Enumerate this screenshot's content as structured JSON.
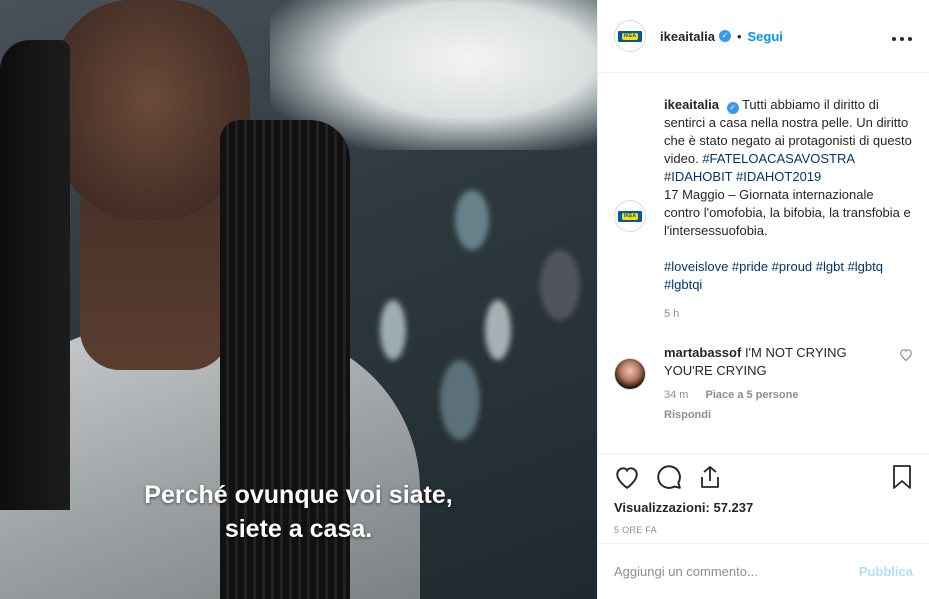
{
  "media": {
    "subtitle_line1": "Perché ovunque voi siate,",
    "subtitle_line2": "siete a casa."
  },
  "header": {
    "username": "ikeaitalia",
    "separator": "•",
    "follow_label": "Segui",
    "more_label": "•••",
    "logo_text": "IKEA"
  },
  "caption": {
    "username": "ikeaitalia",
    "text1": "Tutti abbiamo il diritto di sentirci a casa nella nostra pelle. Un diritto che è stato negato ai protagonisti di questo video.",
    "hashtags1": "#FATELOACASAVOSTRA #IDAHOBIT #IDAHOT2019",
    "text2": "17 Maggio – Giornata internazionale contro l'omofobia, la bifobia, la transfobia e l'intersessuofobia.",
    "hashtags2": "#loveislove #pride #proud #lgbt #lgbtq #lgbtqi",
    "time": "5 h"
  },
  "reply": {
    "username": "martabassof",
    "text": "I'M NOT CRYING YOU'RE CRYING",
    "time": "34 m",
    "likes": "Piace a 5 persone",
    "answer_label": "Rispondi"
  },
  "actions": {
    "views_label": "Visualizzazioni:",
    "views_count": "57.237",
    "posted_ago": "5 ORE FA"
  },
  "add_comment": {
    "placeholder": "Aggiungi un commento...",
    "publish_label": "Pubblica"
  },
  "colors": {
    "link_blue": "#0095f6",
    "hashtag": "#00376b",
    "muted": "#8e8e8e",
    "publish_disabled": "#b2dffc",
    "verified": "#3897f0"
  },
  "icons": [
    "heart-icon",
    "comment-icon",
    "share-icon",
    "bookmark-icon",
    "more-icon",
    "verified-icon"
  ]
}
